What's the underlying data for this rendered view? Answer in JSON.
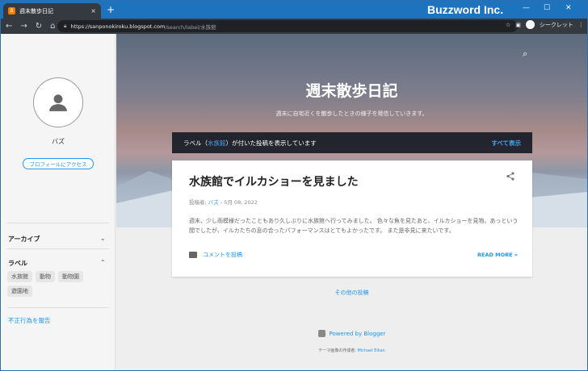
{
  "browser": {
    "tab_title": "週末散歩日記",
    "tab_close": "×",
    "new_tab": "+",
    "brand": "Buzzword Inc.",
    "url_base": "https://sanponokiroku.blogspot.com",
    "url_path": "/search/label/水族館",
    "profile_label": "シークレット",
    "nav_icons": [
      "back-icon",
      "forward-icon",
      "reload-icon",
      "home-icon"
    ]
  },
  "sidebar": {
    "profile_name": "バズ",
    "profile_button": "プロフィールにアクセス",
    "archive_heading": "アーカイブ",
    "labels_heading": "ラベル",
    "labels": [
      "水族館",
      "動物",
      "動物園",
      "遊園地"
    ],
    "report_link": "不正行為を報告"
  },
  "header": {
    "title": "週末散歩日記",
    "description": "週末に自宅近くを散歩したときの様子を発信していきます。"
  },
  "label_bar": {
    "prefix": "ラベル（",
    "label": "水族館",
    "suffix": "）が付いた投稿を表示しています",
    "show_all": "すべて表示"
  },
  "post": {
    "title": "水族館でイルカショーを見ました",
    "author_prefix": "投稿者: ",
    "author": "バズ",
    "date": " - 5月 08, 2022",
    "snippet": "週末、少し雨模様だったこともあり久しぶりに水族館へ行ってみました。 色々な魚を見たあと、イルカショーを見物。あっという間でしたが、イルカたちの息の合ったパフォーマンスはとてもよかったです。 また是非見に来たいです。",
    "comment_link": "コメントを投稿",
    "read_more": "READ MORE »"
  },
  "footer": {
    "older_posts": "その他の投稿",
    "powered_by": "Powered by Blogger",
    "theme_prefix": "テーマ画像の作成者: ",
    "theme_author": "Michael Elkan"
  }
}
